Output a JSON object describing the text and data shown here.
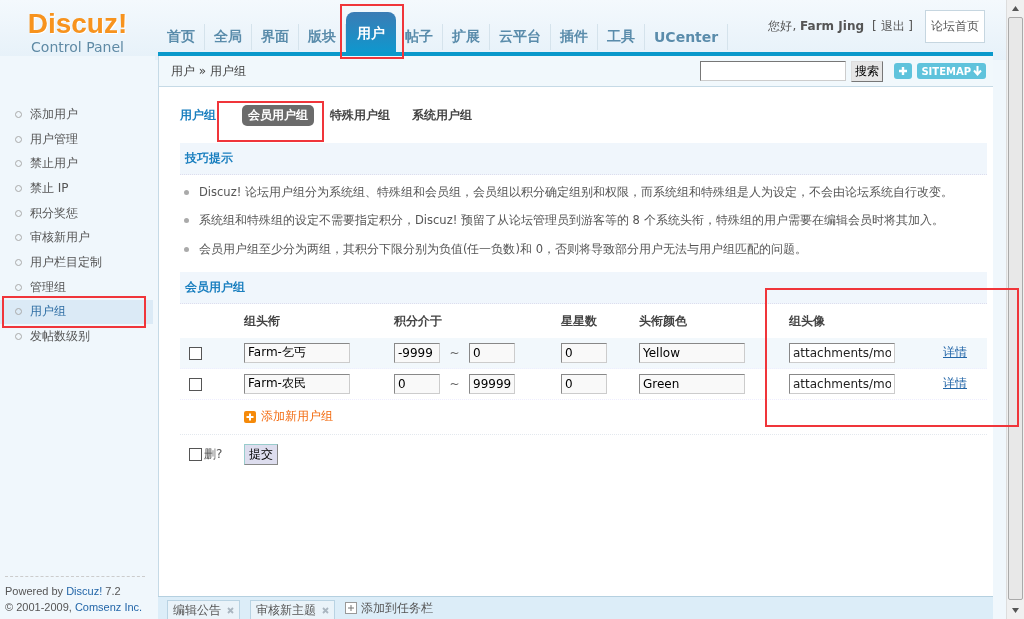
{
  "logo": {
    "name": "Discuz!",
    "subtitle": "Control Panel"
  },
  "nav": [
    {
      "label": "首页",
      "selected": false
    },
    {
      "label": "全局",
      "selected": false
    },
    {
      "label": "界面",
      "selected": false
    },
    {
      "label": "版块",
      "selected": false
    },
    {
      "label": "用户",
      "selected": true
    },
    {
      "label": "帖子",
      "selected": false
    },
    {
      "label": "扩展",
      "selected": false
    },
    {
      "label": "云平台",
      "selected": false
    },
    {
      "label": "插件",
      "selected": false
    },
    {
      "label": "工具",
      "selected": false
    },
    {
      "label": "UCenter",
      "selected": false
    }
  ],
  "user": {
    "greeting": "您好,",
    "name": "Farm Jing",
    "logout": "[ 退出 ]"
  },
  "forum_home": "论坛首页",
  "breadcrumb": "用户 » 用户组",
  "search": {
    "button": "搜索"
  },
  "sitemap": "SITEMAP",
  "sidebar": [
    {
      "label": "添加用户",
      "selected": false
    },
    {
      "label": "用户管理",
      "selected": false
    },
    {
      "label": "禁止用户",
      "selected": false
    },
    {
      "label": "禁止 IP",
      "selected": false
    },
    {
      "label": "积分奖惩",
      "selected": false
    },
    {
      "label": "审核新用户",
      "selected": false
    },
    {
      "label": "用户栏目定制",
      "selected": false
    },
    {
      "label": "管理组",
      "selected": false
    },
    {
      "label": "用户组",
      "selected": true
    },
    {
      "label": "发帖数级别",
      "selected": false
    }
  ],
  "powered": {
    "prefix": "Powered by",
    "link": "Discuz!",
    "suffix": "7.2"
  },
  "copyright": {
    "prefix": "© 2001-2009,",
    "link": "Comsenz Inc."
  },
  "page": {
    "title": "用户组",
    "tabs": [
      {
        "label": "会员用户组",
        "selected": true
      },
      {
        "label": "特殊用户组",
        "selected": false
      },
      {
        "label": "系统用户组",
        "selected": false
      }
    ]
  },
  "tips": {
    "title": "技巧提示",
    "items": [
      "Discuz! 论坛用户组分为系统组、特殊组和会员组，会员组以积分确定组别和权限，而系统组和特殊组是人为设定，不会由论坛系统自行改变。",
      "系统组和特殊组的设定不需要指定积分，Discuz! 预留了从论坛管理员到游客等的 8 个系统头衔，特殊组的用户需要在编辑会员时将其加入。",
      "会员用户组至少分为两组，其积分下限分别为负值(任一负数)和 0，否则将导致部分用户无法与用户组匹配的问题。"
    ]
  },
  "groups": {
    "title": "会员用户组",
    "columns": [
      "组头衔",
      "积分介于",
      "星星数",
      "头衔颜色",
      "组头像"
    ],
    "rows": [
      {
        "checked": false,
        "highlighted": true,
        "title": "Farm-乞丐",
        "min": "-9999",
        "separator": "~",
        "max": "0",
        "star_count": "0",
        "color_name": "Yellow",
        "avatar": "attachments/mo",
        "link": "详情"
      },
      {
        "checked": false,
        "highlighted": false,
        "title": "Farm-农民",
        "min": "0",
        "separator": "~",
        "max": "99999",
        "star_count": "0",
        "color_name": "Green",
        "avatar": "attachments/mo",
        "link": "详情"
      }
    ],
    "add": "添加新用户组",
    "delete_label": "删?",
    "delete_checked": false,
    "submit": "提交"
  },
  "taskbar": {
    "items": [
      {
        "label": "编辑公告",
        "closable": true
      },
      {
        "label": "审核新主题",
        "closable": true
      }
    ],
    "add": "添加到任务栏"
  }
}
